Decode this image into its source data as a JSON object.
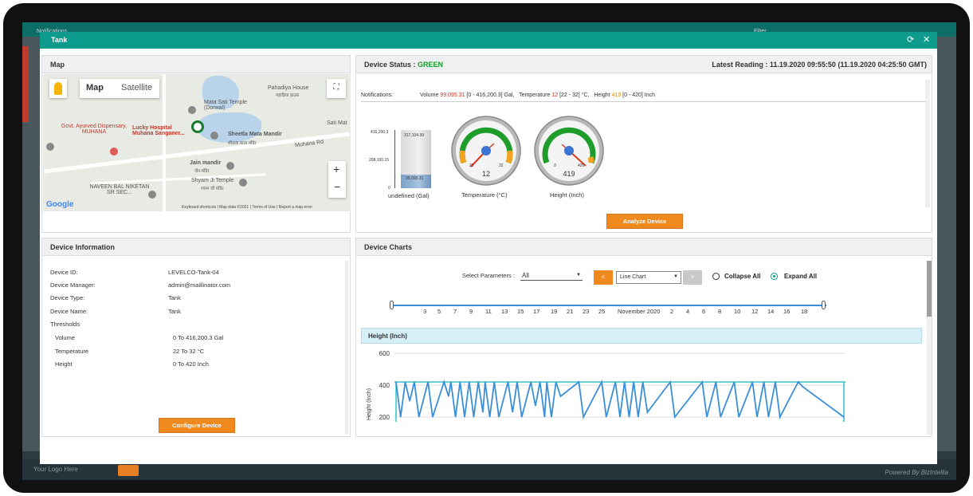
{
  "background": {
    "notifications": "Notifications",
    "filter": "Filter",
    "logo_text": "Your Logo Here",
    "powered_by": "Powered By BizIntellia"
  },
  "modal": {
    "title": "Tank"
  },
  "map": {
    "title": "Map",
    "map_tab": "Map",
    "satellite_tab": "Satellite",
    "footer": [
      "Keyboard shortcuts",
      "Map data ©2021",
      "Terms of Use",
      "Report a map error"
    ],
    "labels": {
      "pahadiya": "Pahadiya House",
      "pahadiya_hi": "पहाड़िया हाउस",
      "mata_sati": "Mata Sati Temple (Dorwal)",
      "sati_mat": "Sati Mat",
      "sheetla": "Sheetla Mata Mandir",
      "sheetla_hi": "शीतला माता मंदिर",
      "govt": "Govt. Ayurved Dispensary, MUHANA",
      "lucky": "Lucky Hospital Muhana Sanganer...",
      "muhana_rd": "Muhana Rd",
      "jain": "Jain mandir",
      "jain_hi": "जैन मंदिर",
      "shyam": "Shyam Ji Temple",
      "shyam_hi": "श्याम जी मंदिर",
      "naveen": "NAVEEN BAL NIKETAN SR SEC...",
      "google": "Google"
    }
  },
  "status": {
    "label": "Device Status :",
    "value": "GREEN",
    "value_color": "#1a9e2a",
    "latest": "Latest Reading : 11.19.2020 09:55:50 (11.19.2020 04:25:50 GMT)",
    "notifications_label": "Notifications:",
    "volume_label": "Volume",
    "volume_value": "99,095.31",
    "volume_range": "[0 - 416,200.3] Gal,",
    "temp_label": "Temperature",
    "temp_value": "12",
    "temp_range": "[22 - 32] °C,",
    "height_label": "Height",
    "height_value": "419",
    "height_range": "[0 - 420] Inch",
    "tank": {
      "ticks": [
        "416,200.3",
        "208,100.15",
        "0"
      ],
      "upper_label": "317,104.99",
      "lower_label": "99,095.31",
      "fill_fraction": 0.238,
      "caption": "undefined (Gal)"
    },
    "gauge_temp": {
      "value": "12",
      "min_label": "22",
      "max_label": "32",
      "caption": "Temperature (°C)"
    },
    "gauge_height": {
      "value": "419",
      "min_label": "0",
      "max_label": "420",
      "caption": "Height (Inch)"
    },
    "analyze_button": "Analyze Device"
  },
  "info": {
    "title": "Device Information",
    "rows": [
      {
        "label": "Device ID:",
        "value": "LEVELCO-Tank-04"
      },
      {
        "label": "Device Manager:",
        "value": "admin@maillinator.com"
      },
      {
        "label": "Device Type:",
        "value": "Tank"
      },
      {
        "label": "Device Name:",
        "value": "Tank"
      }
    ],
    "thresholds_label": "Thresholds",
    "thresholds": [
      {
        "label": "Volume",
        "value": "0 To 416,200.3 Gal"
      },
      {
        "label": "Temperature",
        "value": "22 To 32 °C"
      },
      {
        "label": "Height",
        "value": "0 To 420 Inch"
      }
    ],
    "configure_button": "Configure Device"
  },
  "charts": {
    "title": "Device Charts",
    "select_label": "Select Parameters :",
    "select_value": "All",
    "prev_button": "<",
    "next_button": ">",
    "chart_type": "Line Chart",
    "collapse_all": "Collapse All",
    "expand_all": "Expand All",
    "timeline_labels": [
      "3",
      "5",
      "7",
      "9",
      "11",
      "13",
      "15",
      "17",
      "19",
      "21",
      "23",
      "25",
      "November 2020",
      "2",
      "4",
      "6",
      "8",
      "10",
      "12",
      "14",
      "16",
      "18"
    ],
    "section_title": "Height (Inch)"
  },
  "chart_data": {
    "type": "line",
    "title": "",
    "xlabel": "",
    "ylabel": "Height (Inch)",
    "ylim": [
      170,
      600
    ],
    "yticks": [
      "600",
      "400",
      "200"
    ],
    "color": "#3a8fd8",
    "threshold_color": "#2ec4c4",
    "threshold": 420,
    "series": [
      {
        "x": [
          0,
          2,
          4,
          6,
          8,
          10,
          14,
          16,
          21,
          23,
          24,
          26,
          28,
          30,
          32,
          34,
          36,
          38,
          39,
          41,
          43,
          45,
          49,
          51,
          53,
          55,
          59,
          61,
          63,
          65,
          66,
          68,
          70,
          72,
          80,
          82,
          90,
          92,
          96,
          98,
          100,
          102,
          104,
          106,
          108,
          110,
          120,
          122,
          134,
          136,
          140,
          142,
          148,
          150,
          156,
          158,
          161,
          163,
          166,
          168,
          176,
          178,
          196
        ],
        "values": [
          420,
          200,
          420,
          300,
          420,
          200,
          420,
          200,
          420,
          330,
          420,
          200,
          420,
          200,
          420,
          200,
          420,
          230,
          420,
          200,
          420,
          200,
          420,
          230,
          420,
          200,
          420,
          270,
          420,
          200,
          420,
          200,
          420,
          330,
          420,
          200,
          420,
          200,
          420,
          200,
          420,
          200,
          420,
          200,
          420,
          230,
          420,
          200,
          420,
          200,
          420,
          200,
          420,
          200,
          420,
          200,
          420,
          200,
          420,
          200,
          420,
          390,
          200
        ]
      }
    ]
  }
}
